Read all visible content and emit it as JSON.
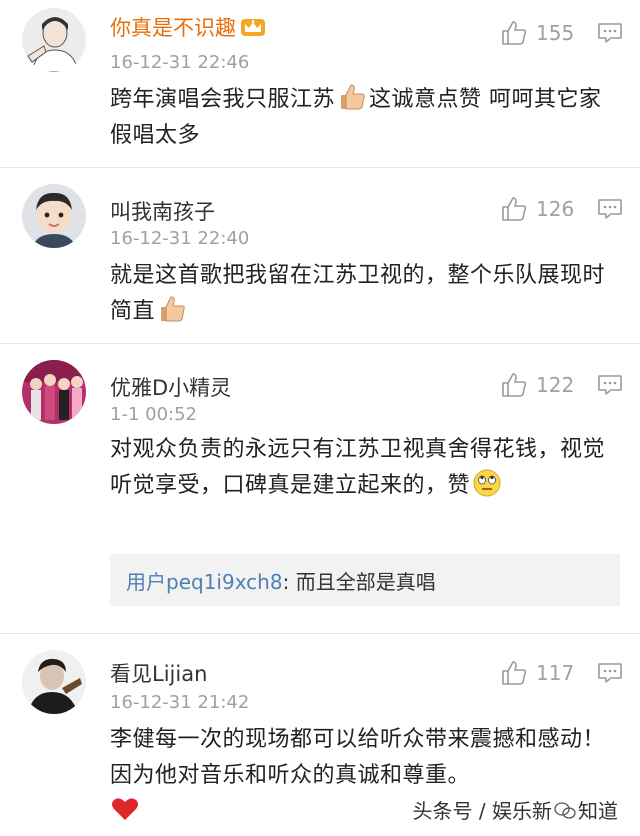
{
  "comments": [
    {
      "username": "你真是不识趣",
      "timestamp": "16-12-31 22:46",
      "likes": "155",
      "text_parts": [
        "跨年演唱会我只服江苏",
        "这诚意点赞 呵呵其它家假唱太多"
      ],
      "icons": [
        "crown-icon",
        "thumbs-up-emoji"
      ]
    },
    {
      "username": "叫我南孩子",
      "timestamp": "16-12-31 22:40",
      "likes": "126",
      "text_parts": [
        "就是这首歌把我留在江苏卫视的，整个乐队展现时简直"
      ],
      "icons": [
        "thumbs-up-emoji"
      ]
    },
    {
      "username": "优雅D小精灵",
      "timestamp": "1-1 00:52",
      "likes": "122",
      "text_parts": [
        "对观众负责的永远只有江苏卫视真舍得花钱，视觉听觉享受，口碑真是建立起来的，赞"
      ],
      "icons": [
        "eye-roll-emoji"
      ],
      "reply": {
        "user": "用户peq1i9xch8",
        "text": ": 而且全部是真唱"
      }
    },
    {
      "username": "看见Lijian",
      "timestamp": "16-12-31 21:42",
      "likes": "117",
      "text_parts": [
        "李健每一次的现场都可以给听众带来震撼和感动！因为他对音乐和听众的真诚和尊重。"
      ],
      "icons": [
        "red-heart-emoji"
      ]
    }
  ],
  "watermark": {
    "prefix": "头条号 / 娱乐新",
    "suffix": "知道"
  },
  "colors": {
    "username_highlight": "#e8700b",
    "reply_user": "#4e7fb5",
    "meta": "#a0a0a0"
  }
}
